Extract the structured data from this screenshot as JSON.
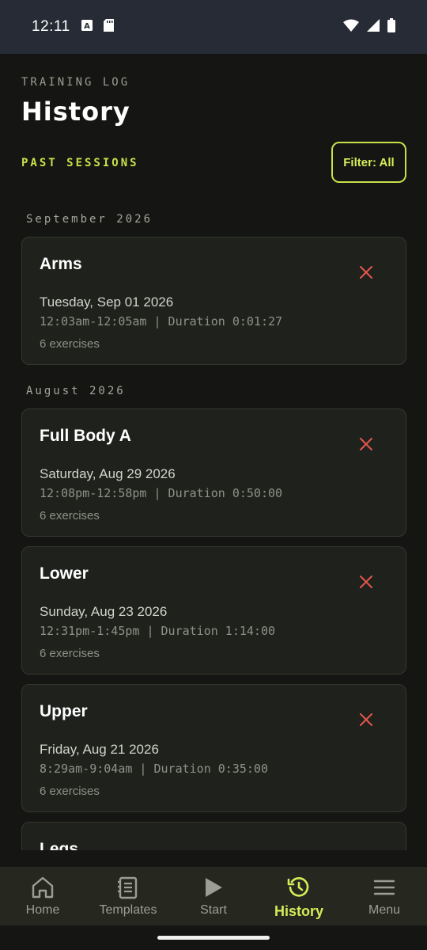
{
  "status_bar": {
    "time": "12:11"
  },
  "header": {
    "overline": "TRAINING LOG",
    "title": "History",
    "section_label": "PAST SESSIONS",
    "filter_label": "Filter: All"
  },
  "months": [
    "September 2026",
    "August 2026"
  ],
  "sessions": [
    {
      "name": "Arms",
      "date": "Tuesday, Sep 01 2026",
      "times": "12:03am-12:05am | Duration 0:01:27",
      "exercises": "6 exercises"
    },
    {
      "name": "Full Body A",
      "date": "Saturday, Aug 29 2026",
      "times": "12:08pm-12:58pm | Duration 0:50:00",
      "exercises": "6 exercises"
    },
    {
      "name": "Lower",
      "date": "Sunday, Aug 23 2026",
      "times": "12:31pm-1:45pm | Duration 1:14:00",
      "exercises": "6 exercises"
    },
    {
      "name": "Upper",
      "date": "Friday, Aug 21 2026",
      "times": "8:29am-9:04am | Duration 0:35:00",
      "exercises": "6 exercises"
    },
    {
      "name": "Legs"
    }
  ],
  "nav": [
    {
      "label": "Home",
      "icon": "home-icon"
    },
    {
      "label": "Templates",
      "icon": "templates-icon"
    },
    {
      "label": "Start",
      "icon": "play-icon"
    },
    {
      "label": "History",
      "icon": "history-icon",
      "active": true
    },
    {
      "label": "Menu",
      "icon": "menu-icon"
    }
  ],
  "colors": {
    "accent": "#c8e04a",
    "delete": "#e2574c",
    "background": "#151613",
    "card": "#1f211d"
  }
}
